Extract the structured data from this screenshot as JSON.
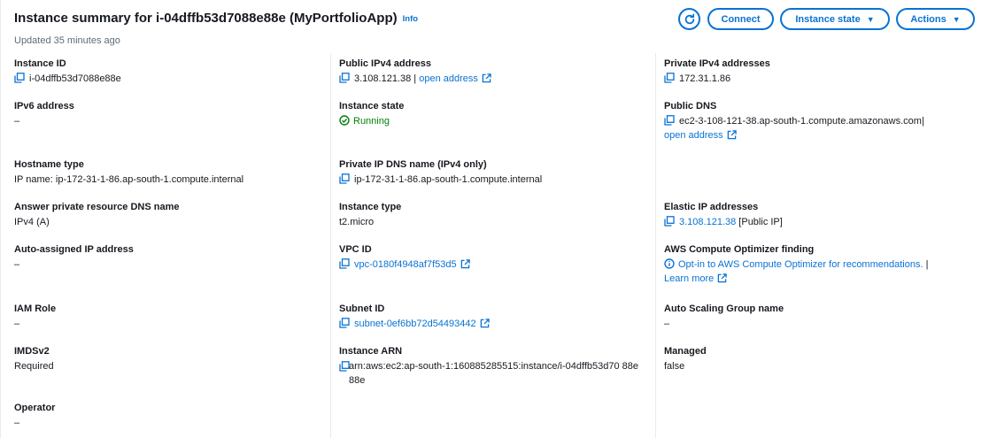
{
  "header": {
    "title": "Instance summary for i-04dffb53d7088e88e (MyPortfolioApp)",
    "info_link": "Info",
    "updated": "Updated 35 minutes ago",
    "buttons": {
      "refresh_icon": "refresh-icon",
      "connect": "Connect",
      "instance_state": "Instance state",
      "actions": "Actions"
    }
  },
  "col1": {
    "instance_id": {
      "label": "Instance ID",
      "value": "i-04dffb53d7088e88e"
    },
    "ipv6": {
      "label": "IPv6 address",
      "value": "–"
    },
    "hostname_type": {
      "label": "Hostname type",
      "value": "IP name: ip-172-31-1-86.ap-south-1.compute.internal"
    },
    "answer_dns": {
      "label": "Answer private resource DNS name",
      "value": "IPv4 (A)"
    },
    "auto_ip": {
      "label": "Auto-assigned IP address",
      "value": "–"
    },
    "iam_role": {
      "label": "IAM Role",
      "value": "–"
    },
    "imdsv2": {
      "label": "IMDSv2",
      "value": "Required"
    },
    "operator": {
      "label": "Operator",
      "value": "–"
    }
  },
  "col2": {
    "public_ipv4": {
      "label": "Public IPv4 address",
      "value": "3.108.121.38",
      "sep": "|",
      "link": "open address"
    },
    "instance_state": {
      "label": "Instance state",
      "value": "Running"
    },
    "private_dns": {
      "label": "Private IP DNS name (IPv4 only)",
      "value": "ip-172-31-1-86.ap-south-1.compute.internal"
    },
    "instance_type": {
      "label": "Instance type",
      "value": "t2.micro"
    },
    "vpc_id": {
      "label": "VPC ID",
      "value": "vpc-0180f4948af7f53d5"
    },
    "subnet_id": {
      "label": "Subnet ID",
      "value": "subnet-0ef6bb72d54493442"
    },
    "instance_arn": {
      "label": "Instance ARN",
      "value": "arn:aws:ec2:ap-south-1:160885285515:instance/i-04dffb53d70 88e88e"
    }
  },
  "col3": {
    "private_ipv4": {
      "label": "Private IPv4 addresses",
      "value": "172.31.1.86"
    },
    "public_dns": {
      "label": "Public DNS",
      "value": "ec2-3-108-121-38.ap-south-1.compute.amazonaws.com",
      "sep": "|",
      "link": "open address"
    },
    "elastic_ip": {
      "label": "Elastic IP addresses",
      "value": "3.108.121.38",
      "suffix": "[Public IP]"
    },
    "optimizer": {
      "label": "AWS Compute Optimizer finding",
      "value": "Opt-in to AWS Compute Optimizer for recommendations.",
      "sep": "|",
      "link": "Learn more"
    },
    "asg_name": {
      "label": "Auto Scaling Group name",
      "value": "–"
    },
    "managed": {
      "label": "Managed",
      "value": "false"
    }
  },
  "colors": {
    "link": "#0972d3",
    "success": "#037f0c",
    "text": "#16191f",
    "muted": "#5f6b7a",
    "divider": "#e9ebed"
  }
}
